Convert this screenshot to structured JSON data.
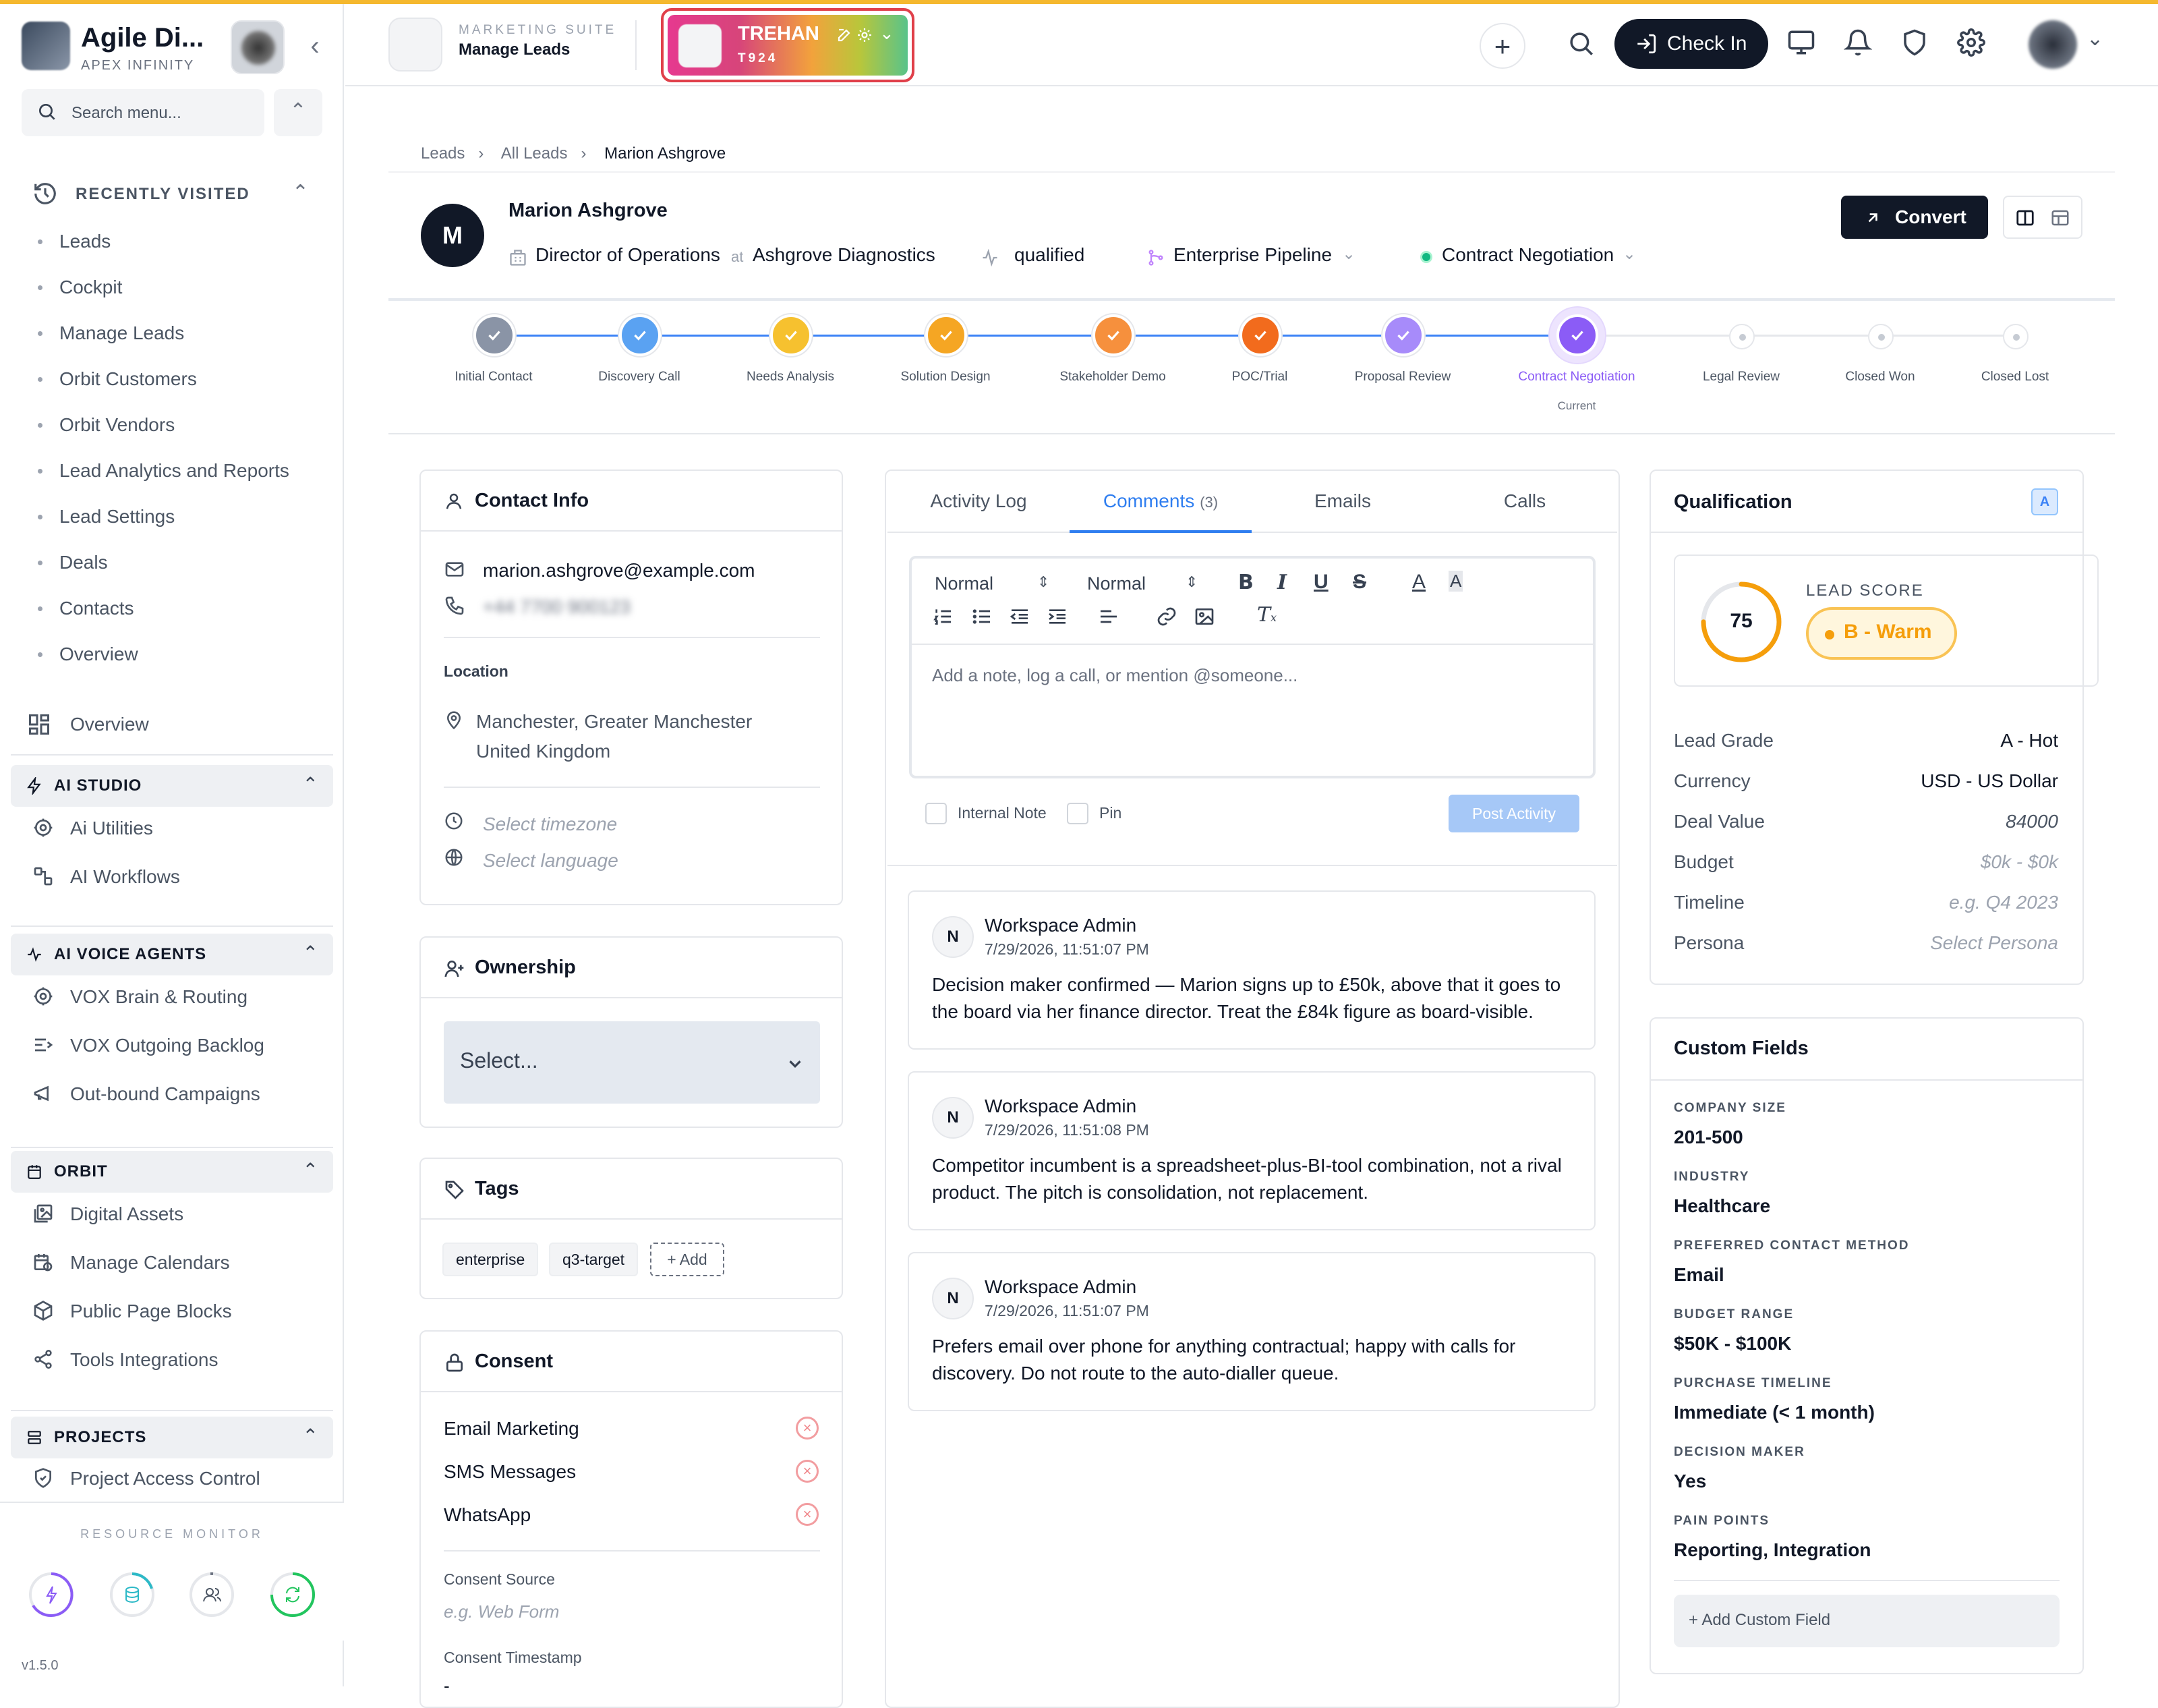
{
  "sidebar": {
    "brand": "Agile Di...",
    "brand_sub": "APEX INFINITY",
    "search_placeholder": "Search menu...",
    "recent_title": "RECENTLY VISITED",
    "recent_items": [
      "Leads",
      "Cockpit",
      "Manage Leads",
      "Orbit Customers",
      "Orbit Vendors",
      "Lead Analytics and Reports",
      "Lead Settings",
      "Deals",
      "Contacts",
      "Overview"
    ],
    "overview": "Overview",
    "sections": [
      {
        "title": "AI STUDIO",
        "items": [
          "Ai Utilities",
          "AI Workflows"
        ]
      },
      {
        "title": "AI VOICE AGENTS",
        "items": [
          "VOX Brain & Routing",
          "VOX Outgoing Backlog",
          "Out-bound Campaigns"
        ]
      },
      {
        "title": "ORBIT",
        "items": [
          "Digital Assets",
          "Manage Calendars",
          "Public Page Blocks",
          "Tools Integrations"
        ]
      },
      {
        "title": "PROJECTS",
        "items": [
          "Project Access Control"
        ]
      }
    ],
    "resource_monitor": "RESOURCE MONITOR",
    "version": "v1.5.0"
  },
  "header": {
    "app_sub": "MARKETING SUITE",
    "app_title": "Manage Leads",
    "tenant_name": "TREHAN",
    "tenant_code": "T924",
    "check_in": "Check In"
  },
  "breadcrumb": [
    "Leads",
    "All Leads",
    "Marion Ashgrove"
  ],
  "lead": {
    "initial": "M",
    "name": "Marion Ashgrove",
    "title": "Director of Operations",
    "at": "at",
    "company": "Ashgrove Diagnostics",
    "status": "qualified",
    "pipeline": "Enterprise Pipeline",
    "stage": "Contract Negotiation",
    "convert": "Convert"
  },
  "pipeline": {
    "stages": [
      {
        "label": "Initial Contact",
        "color": "#8a94a6",
        "done": true
      },
      {
        "label": "Discovery Call",
        "color": "#5aa2f2",
        "done": true
      },
      {
        "label": "Needs Analysis",
        "color": "#f6c12f",
        "done": true
      },
      {
        "label": "Solution Design",
        "color": "#f5a623",
        "done": true
      },
      {
        "label": "Stakeholder Demo",
        "color": "#f6903d",
        "done": true
      },
      {
        "label": "POC/Trial",
        "color": "#f26b1d",
        "done": true
      },
      {
        "label": "Proposal Review",
        "color": "#a78bfa",
        "done": true
      },
      {
        "label": "Contract Negotiation",
        "color": "#8b5cf6",
        "done": true,
        "current": true
      },
      {
        "label": "Legal Review",
        "done": false
      },
      {
        "label": "Closed Won",
        "done": false
      },
      {
        "label": "Closed Lost",
        "done": false
      }
    ],
    "current_label": "Current"
  },
  "contact": {
    "title": "Contact Info",
    "email": "marion.ashgrove@example.com",
    "phone": "+44 7700 900123",
    "location_label": "Location",
    "location_line1": "Manchester, Greater Manchester",
    "location_line2": "United Kingdom",
    "timezone_placeholder": "Select timezone",
    "language_placeholder": "Select language"
  },
  "ownership": {
    "title": "Ownership",
    "select": "Select..."
  },
  "tags": {
    "title": "Tags",
    "items": [
      "enterprise",
      "q3-target"
    ],
    "add": "+ Add"
  },
  "consent": {
    "title": "Consent",
    "items": [
      "Email Marketing",
      "SMS Messages",
      "WhatsApp"
    ],
    "source_label": "Consent Source",
    "source_placeholder": "e.g. Web Form",
    "timestamp_label": "Consent Timestamp",
    "timestamp_value": "-"
  },
  "tabs": [
    {
      "label": "Activity Log"
    },
    {
      "label": "Comments",
      "count": "(3)"
    },
    {
      "label": "Emails"
    },
    {
      "label": "Calls"
    }
  ],
  "editor": {
    "style1": "Normal",
    "style2": "Normal",
    "placeholder": "Add a note, log a call, or mention @someone...",
    "internal_note": "Internal Note",
    "pin": "Pin",
    "post": "Post Activity"
  },
  "comments": [
    {
      "initial": "N",
      "author": "Workspace Admin",
      "time": "7/29/2026, 11:51:07 PM",
      "body": "Decision maker confirmed — Marion signs up to £50k, above that it goes to the board via her finance director. Treat the £84k figure as board-visible."
    },
    {
      "initial": "N",
      "author": "Workspace Admin",
      "time": "7/29/2026, 11:51:08 PM",
      "body": "Competitor incumbent is a spreadsheet-plus-BI-tool combination, not a rival product. The pitch is consolidation, not replacement."
    },
    {
      "initial": "N",
      "author": "Workspace Admin",
      "time": "7/29/2026, 11:51:07 PM",
      "body": "Prefers email over phone for anything contractual; happy with calls for discovery. Do not route to the auto-dialler queue."
    }
  ],
  "qualification": {
    "title": "Qualification",
    "badge": "A",
    "score": "75",
    "score_fraction": 0.75,
    "score_label": "LEAD SCORE",
    "warmth": "B - Warm",
    "rows": [
      {
        "label": "Lead Grade",
        "value": "A - Hot",
        "placeholder": false
      },
      {
        "label": "Currency",
        "value": "USD - US Dollar",
        "placeholder": false
      },
      {
        "label": "Deal Value",
        "value": "84000",
        "italic": true
      },
      {
        "label": "Budget",
        "value": "$0k - $0k",
        "placeholder": true
      },
      {
        "label": "Timeline",
        "value": "e.g. Q4 2023",
        "placeholder": true
      },
      {
        "label": "Persona",
        "value": "Select Persona",
        "placeholder": true
      }
    ]
  },
  "custom_fields": {
    "title": "Custom Fields",
    "items": [
      {
        "label": "COMPANY SIZE",
        "value": "201-500"
      },
      {
        "label": "INDUSTRY",
        "value": "Healthcare"
      },
      {
        "label": "PREFERRED CONTACT METHOD",
        "value": "Email"
      },
      {
        "label": "BUDGET RANGE",
        "value": "$50K - $100K"
      },
      {
        "label": "PURCHASE TIMELINE",
        "value": "Immediate (< 1 month)"
      },
      {
        "label": "DECISION MAKER",
        "value": "Yes"
      },
      {
        "label": "PAIN POINTS",
        "value": "Reporting, Integration"
      }
    ],
    "add": "+ Add Custom Field"
  },
  "colors": {
    "accent": "#2f7ef0",
    "dark": "#111827",
    "topbar": "#f5b82e",
    "score": "#f59e0b"
  }
}
